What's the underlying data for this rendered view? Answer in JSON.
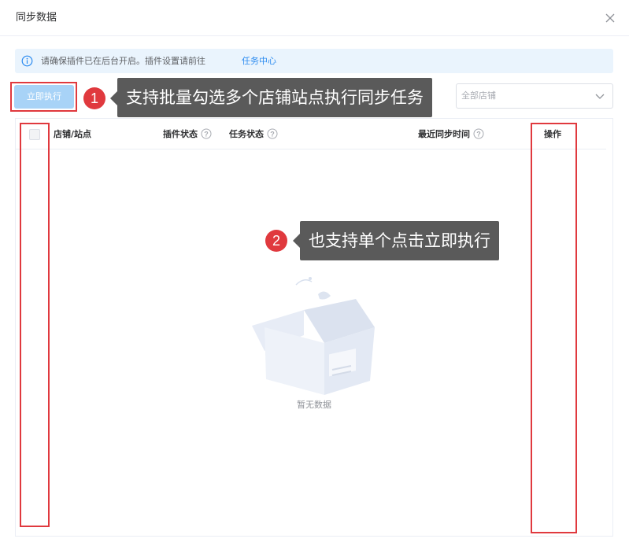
{
  "dialog": {
    "title": "同步数据",
    "close_icon": "close-icon"
  },
  "notice": {
    "icon": "info-icon",
    "text": "请确保插件已在后台开启。插件设置请前往",
    "link": "任务中心"
  },
  "toolbar": {
    "run_label": "立即执行",
    "store_select_placeholder": "全部店铺",
    "store_select_icon": "chevron-down-icon"
  },
  "table": {
    "columns": [
      {
        "label": "店铺/站点",
        "help": false
      },
      {
        "label": "插件状态",
        "help": true
      },
      {
        "label": "任务状态",
        "help": true
      },
      {
        "label": "最近同步时间",
        "help": true
      },
      {
        "label": "操作",
        "help": false
      }
    ],
    "rows": [],
    "empty_text": "暂无数据"
  },
  "annotations": [
    {
      "number": "1",
      "text": "支持批量勾选多个店铺站点执行同步任务"
    },
    {
      "number": "2",
      "text": "也支持单个点击立即执行"
    }
  ],
  "colors": {
    "annotation_red": "#e0393e",
    "callout_bg": "#5a5a5a",
    "primary_disabled": "#a8d3f7",
    "link": "#2d8cf0",
    "notice_bg": "#eaf4fd"
  }
}
